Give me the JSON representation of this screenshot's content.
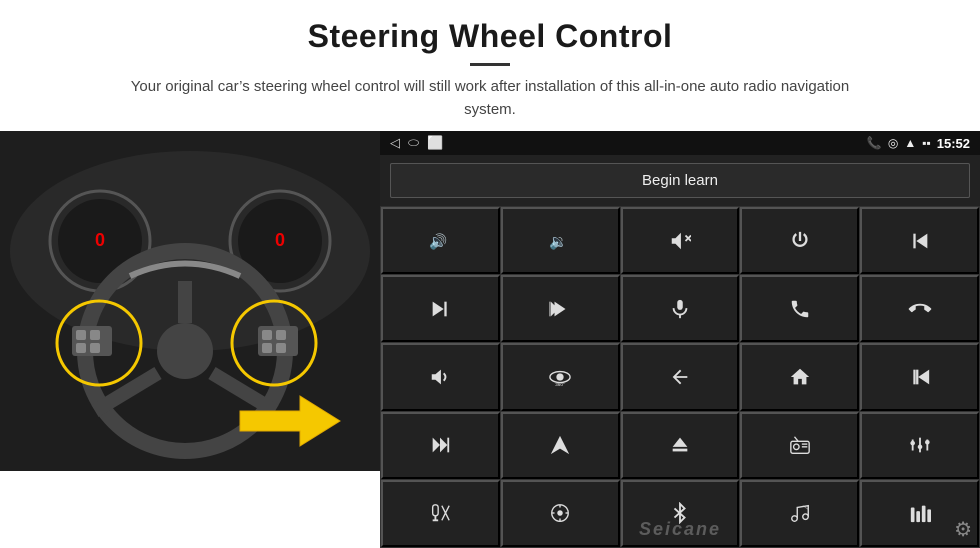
{
  "header": {
    "title": "Steering Wheel Control",
    "divider": true,
    "subtitle": "Your original car’s steering wheel control will still work after installation of this all-in-one auto radio navigation system."
  },
  "status_bar": {
    "nav_icons": [
      "◁",
      "○",
      "□"
    ],
    "right_icons": [
      "📞",
      "◎",
      "🔺",
      "🔋"
    ],
    "time": "15:52",
    "signal": "▪▪▪"
  },
  "begin_learn": {
    "label": "Begin learn"
  },
  "controls": [
    {
      "id": "vol-up",
      "icon": "vol_up",
      "aria": "Volume Up"
    },
    {
      "id": "vol-down",
      "icon": "vol_down",
      "aria": "Volume Down"
    },
    {
      "id": "mute",
      "icon": "mute",
      "aria": "Mute"
    },
    {
      "id": "power",
      "icon": "power",
      "aria": "Power"
    },
    {
      "id": "prev-track-hold",
      "icon": "prev_hold",
      "aria": "Previous Track Hold"
    },
    {
      "id": "next-track",
      "icon": "next_track",
      "aria": "Next Track"
    },
    {
      "id": "prev-seek",
      "icon": "prev_seek",
      "aria": "Previous Seek"
    },
    {
      "id": "mic",
      "icon": "mic",
      "aria": "Microphone"
    },
    {
      "id": "phone",
      "icon": "phone",
      "aria": "Phone"
    },
    {
      "id": "hang-up",
      "icon": "hang_up",
      "aria": "Hang Up"
    },
    {
      "id": "horn",
      "icon": "horn",
      "aria": "Horn/Alert"
    },
    {
      "id": "360-cam",
      "icon": "cam360",
      "aria": "360 Camera"
    },
    {
      "id": "back",
      "icon": "back",
      "aria": "Back"
    },
    {
      "id": "home",
      "icon": "home",
      "aria": "Home"
    },
    {
      "id": "prev-chapter",
      "icon": "prev_chapter",
      "aria": "Previous Chapter"
    },
    {
      "id": "fast-fwd",
      "icon": "fast_fwd",
      "aria": "Fast Forward"
    },
    {
      "id": "navigate",
      "icon": "navigate",
      "aria": "Navigate"
    },
    {
      "id": "eject",
      "icon": "eject",
      "aria": "Eject"
    },
    {
      "id": "radio",
      "icon": "radio",
      "aria": "Radio"
    },
    {
      "id": "equalizer",
      "icon": "equalizer",
      "aria": "Equalizer"
    },
    {
      "id": "mic2",
      "icon": "mic2",
      "aria": "Microphone 2"
    },
    {
      "id": "menu-wheel",
      "icon": "menu_wheel",
      "aria": "Menu Wheel"
    },
    {
      "id": "bluetooth",
      "icon": "bluetooth",
      "aria": "Bluetooth"
    },
    {
      "id": "music",
      "icon": "music",
      "aria": "Music"
    },
    {
      "id": "eq-bars",
      "icon": "eq_bars",
      "aria": "EQ Bars"
    }
  ],
  "watermark": "Seicane",
  "gear_icon": "⚙"
}
